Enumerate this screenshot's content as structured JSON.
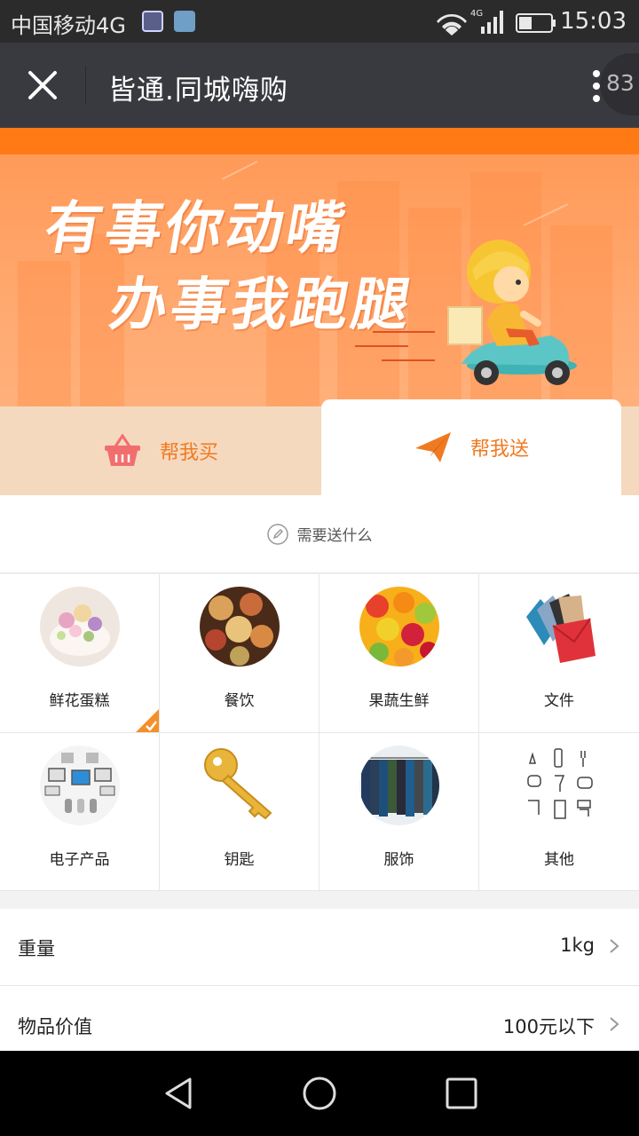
{
  "status_bar": {
    "carrier": "中国移动4G",
    "network": "4G",
    "time": "15:03"
  },
  "title_bar": {
    "title": "皆通.同城嗨购",
    "badge": "83"
  },
  "banner": {
    "line1": "有事你动嘴",
    "line2": "办事我跑腿",
    "colors": {
      "strip": "#ff7a14",
      "bg": "#ffa970"
    }
  },
  "tabs": [
    {
      "label": "帮我买",
      "icon": "basket-icon",
      "active": false
    },
    {
      "label": "帮我送",
      "icon": "paper-plane-icon",
      "active": true
    }
  ],
  "hint": {
    "text": "需要送什么",
    "icon": "edit-icon"
  },
  "categories": [
    {
      "label": "鲜花蛋糕",
      "selected": true
    },
    {
      "label": "餐饮",
      "selected": false
    },
    {
      "label": "果蔬生鲜",
      "selected": false
    },
    {
      "label": "文件",
      "selected": false
    },
    {
      "label": "电子产品",
      "selected": false
    },
    {
      "label": "钥匙",
      "selected": false
    },
    {
      "label": "服饰",
      "selected": false
    },
    {
      "label": "其他",
      "selected": false
    }
  ],
  "form": {
    "weight": {
      "label": "重量",
      "value": "1kg"
    },
    "value": {
      "label": "物品价值",
      "value": "100元以下"
    }
  },
  "accent_color": "#f07a21"
}
